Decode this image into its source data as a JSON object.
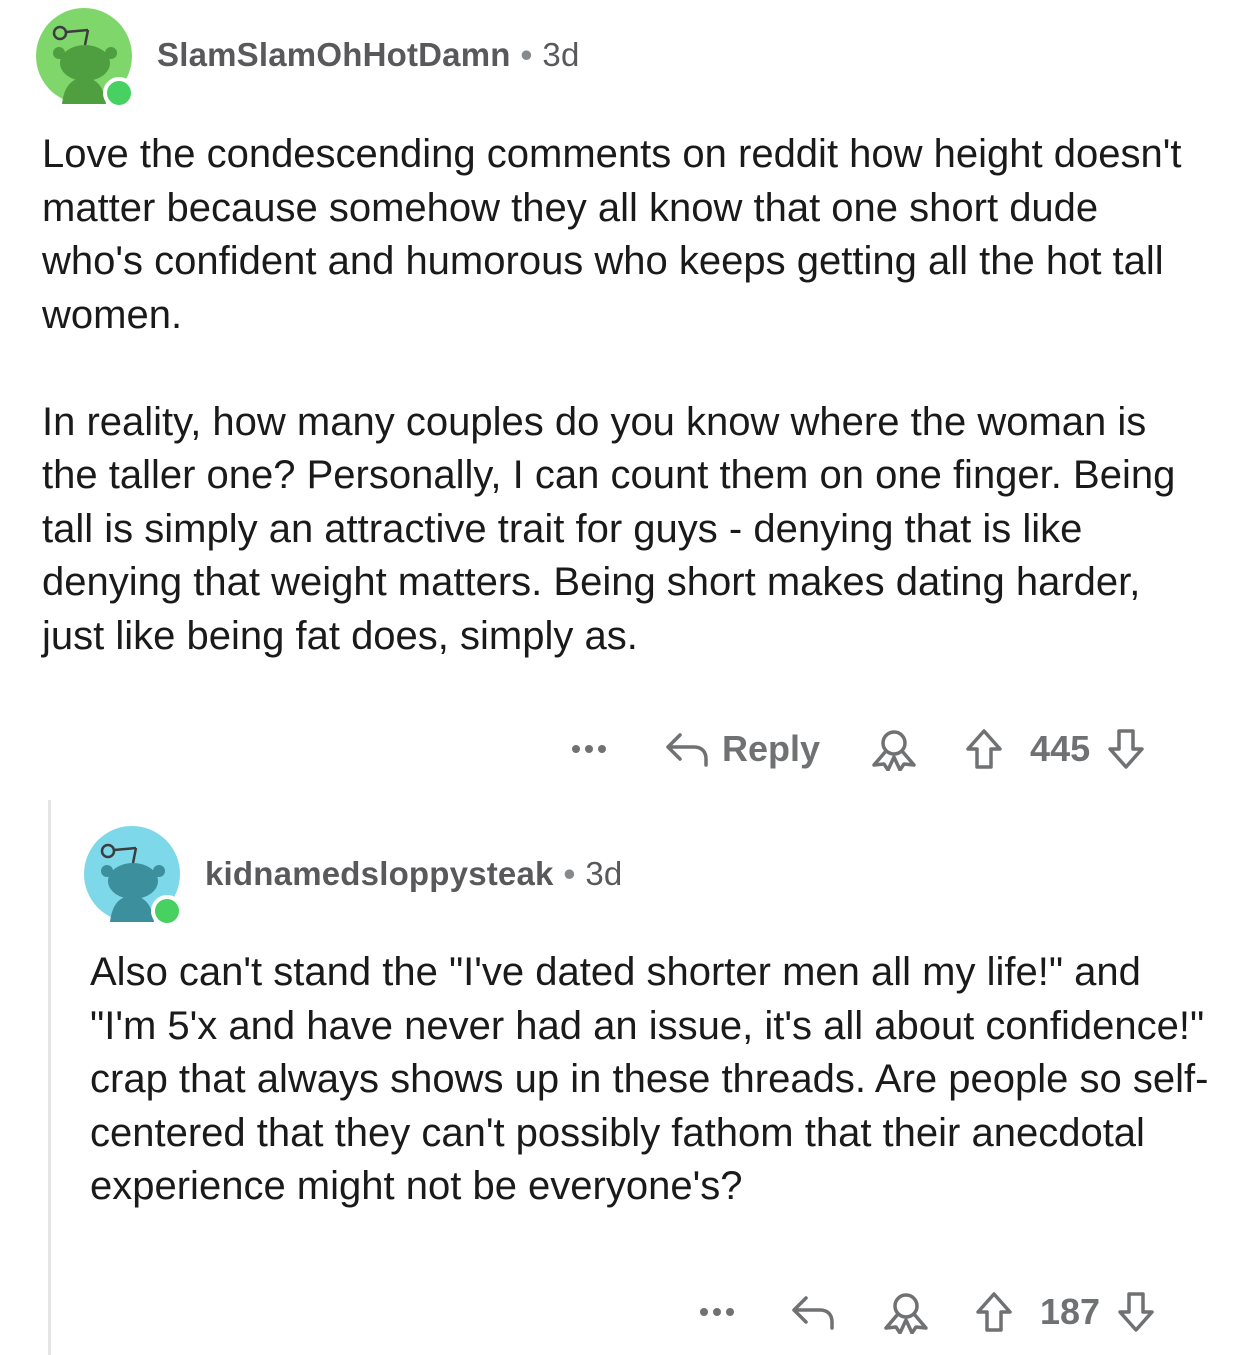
{
  "comments": [
    {
      "username": "SlamSlamOhHotDamn",
      "age": "3d",
      "avatar_color": "#7fd66a",
      "paragraphs": [
        "Love the condescending comments on reddit how height doesn't matter because somehow they all know that one short dude who's confident and humorous who keeps getting all the hot tall women.",
        "In reality, how many couples do you know where the woman is the taller one? Personally, I can count them on one finger. Being tall is simply an attractive trait for guys - denying that is like denying that weight matters. Being short makes dating harder, just like being fat does, simply as."
      ],
      "reply_label": "Reply",
      "score": "445"
    },
    {
      "username": "kidnamedsloppysteak",
      "age": "3d",
      "avatar_color": "#7dd8ea",
      "paragraphs": [
        "Also can't stand the \"I've dated shorter men all my life!\" and \"I'm 5'x and have never had an issue, it's all about confidence!\" crap that always shows up in these threads. Are people so self-centered that they can't possibly fathom that their anecdotal experience might not be everyone's?"
      ],
      "score": "187"
    }
  ],
  "separator": "•",
  "icons": {
    "more": "more-options-icon",
    "reply": "reply-arrow-icon",
    "award": "award-icon",
    "upvote": "upvote-arrow-icon",
    "downvote": "downvote-arrow-icon"
  },
  "colors": {
    "text": "#1a1a1b",
    "meta": "#6f7173",
    "online": "#46d160",
    "thread_line": "#e5e5e6"
  }
}
